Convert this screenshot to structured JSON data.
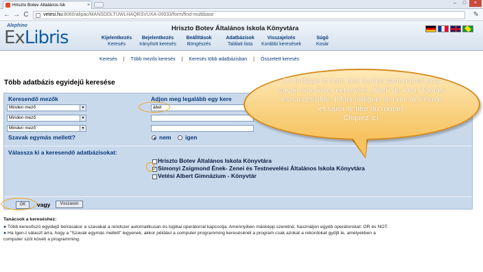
{
  "browser": {
    "tab_title": "Hriszto Botev Általános Isk",
    "tab_close": "×",
    "url_host": "vetesi.hu",
    "url_path": ":8060/alipac/MANSDDLTUWLHAQRSVUXA-00033/form/find-multibase",
    "back": "←",
    "forward": "→",
    "reload": "C",
    "wrench": "✎",
    "min": "–",
    "max": "□",
    "close": "×"
  },
  "header": {
    "aleph": "Alephino",
    "logo_ex": "Ex",
    "logo_libris": "Libris",
    "library_title": "Hriszto Botev Általános Iskola Könyvtára",
    "menu": [
      {
        "top": "Kijelentkezés",
        "sub": "Keresés"
      },
      {
        "top": "Bejelentkezés",
        "sub": "Irányított keresés"
      },
      {
        "top": "Beállítások",
        "sub": "Böngészés"
      },
      {
        "top": "Adatbázisok",
        "sub": "Találati lista"
      },
      {
        "top": "Visszajelzés",
        "sub": "Korábbi keresések"
      },
      {
        "top": "Súgó",
        "sub": "Kosár"
      }
    ]
  },
  "subnav": {
    "items": [
      "Keresés",
      "Több mezős keresés",
      "Keresés több adatbázisban",
      "Összetett keresés"
    ],
    "sep": "|"
  },
  "page_title": "Több adatbázis egyidejű keresése",
  "form": {
    "fields_label": "Keresendő mezők",
    "terms_label": "Adjon meg legalább egy kere",
    "field_selects": [
      "Minden mező",
      "Minden mező",
      "Minden mező"
    ],
    "select_arrow": "▼",
    "term_values": [
      "ábel",
      "",
      ""
    ],
    "adjacent_label": "Szavak egymás mellett?",
    "adjacent_no": "nem",
    "adjacent_yes": "igen",
    "db_label": "Válassza ki a keresendő adatbázisokat:",
    "databases": [
      {
        "name": "Hriszto Botev Általános Iskola Könyvtára",
        "checked": ""
      },
      {
        "name": "Simonyi Zsigmond Ének- Zenei és Testnevelési Általános Iskola Könyvtára",
        "checked": "✓"
      },
      {
        "name": "Vetési Albert Gimnázium - Könyvtár",
        "checked": ""
      }
    ],
    "ok_label": "OK",
    "or_label": "vagy",
    "clear_label": "Visszavon"
  },
  "tips": {
    "title": "Tanácsok a kereséshez:",
    "bullet": "●",
    "line1": "Több keresőszó egyidejű beírásakor a szavakat a rendszer automatikusan és logikai operátorral kapcsolja. Amennyiben másképp szeretné, használjon egyéb operátorokat: OR és NOT.",
    "line2": "Ha Igen-t választ arra, hogy a \"Szavak egymás mellett\" legyenek, akkor például a computer programming keresésénél a program csak azokat a rekordokat gyűjti le, amelyekben a",
    "line3": "computer szót követi a programming."
  },
  "callout": {
    "lines": [
      "On indique le nom des écoles partenaires pour",
      "savoir si le livre recherché „Ábel” de Áron Tamási",
      "est accessible. Il faut indiquer le nom de l’école",
      "et saisir le titre du roman.",
      "Cliquez ici."
    ]
  },
  "colors": {
    "panel": "#c9d9ec",
    "link": "#0a3a7a",
    "callout": "#f7c360",
    "highlight": "#f4a31a"
  }
}
